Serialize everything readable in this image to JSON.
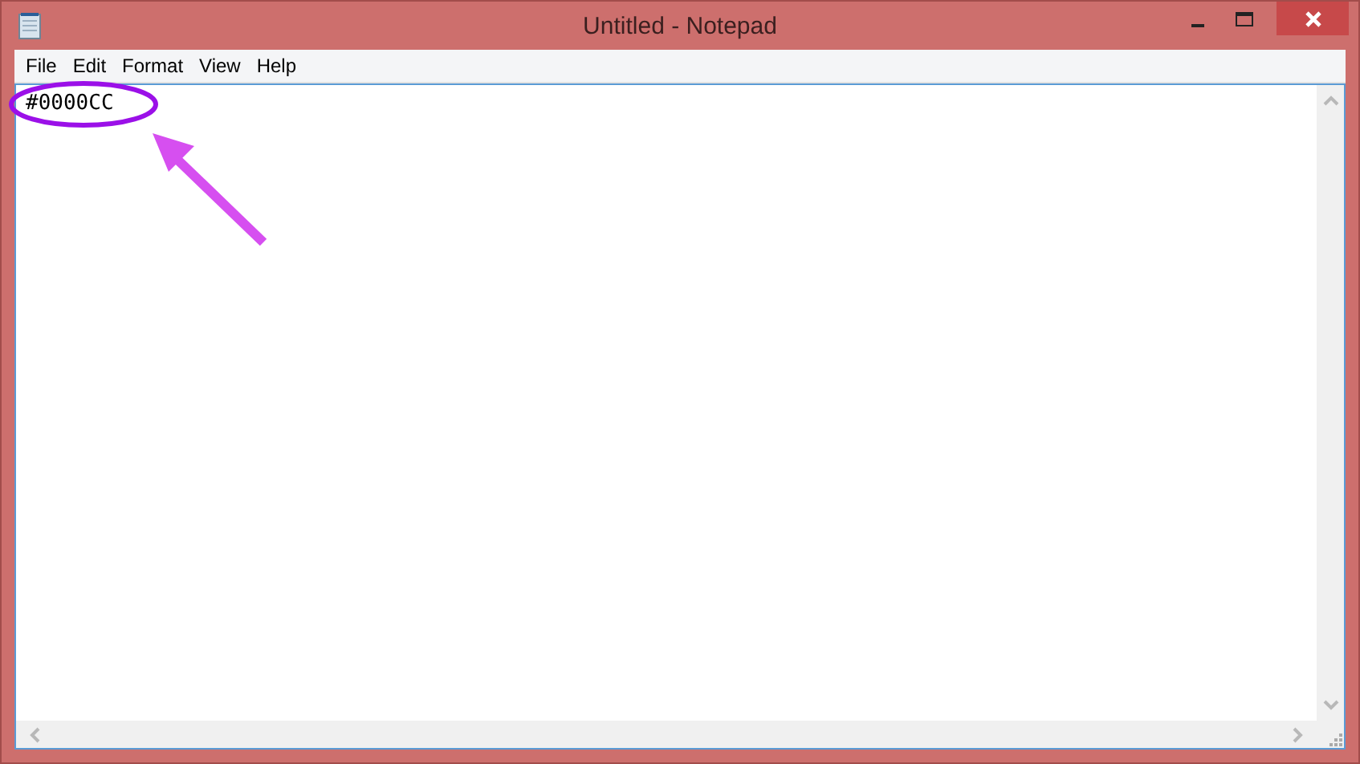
{
  "window": {
    "title": "Untitled - Notepad"
  },
  "menu": [
    {
      "label": "File"
    },
    {
      "label": "Edit"
    },
    {
      "label": "Format"
    },
    {
      "label": "View"
    },
    {
      "label": "Help"
    }
  ],
  "editor": {
    "value": "#0000CC"
  }
}
